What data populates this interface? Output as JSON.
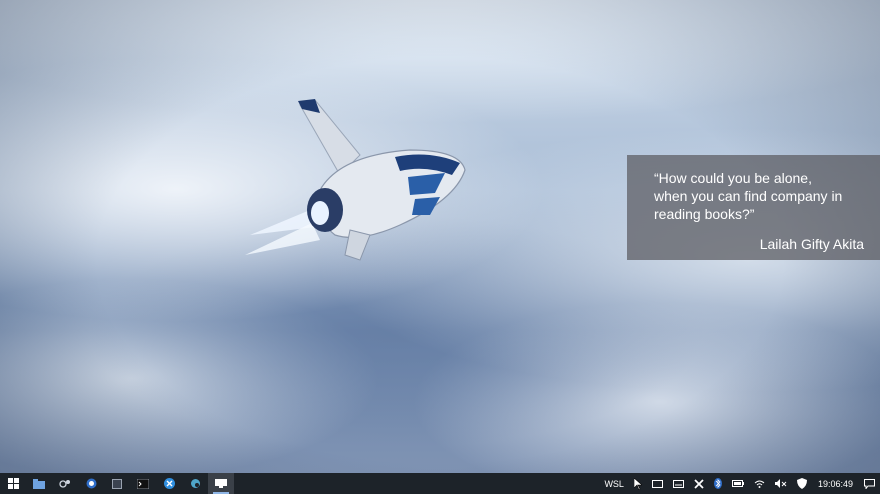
{
  "wallpaper": {
    "scene": "spaceship-over-clouds"
  },
  "quote": {
    "text": "“How could you be alone,\nwhen you can find company in\nreading books?”",
    "author": "Lailah Gifty Akita"
  },
  "taskbar": {
    "pinned": [
      {
        "name": "start-icon"
      },
      {
        "name": "file-explorer-icon"
      },
      {
        "name": "app-icon"
      },
      {
        "name": "browser-icon"
      },
      {
        "name": "app-icon"
      },
      {
        "name": "terminal-icon"
      },
      {
        "name": "x-app-icon"
      },
      {
        "name": "app-icon"
      },
      {
        "name": "remote-desktop-icon",
        "active": true
      }
    ],
    "tray": {
      "wsl_label": "WSL",
      "clock": "19:06:49"
    }
  }
}
